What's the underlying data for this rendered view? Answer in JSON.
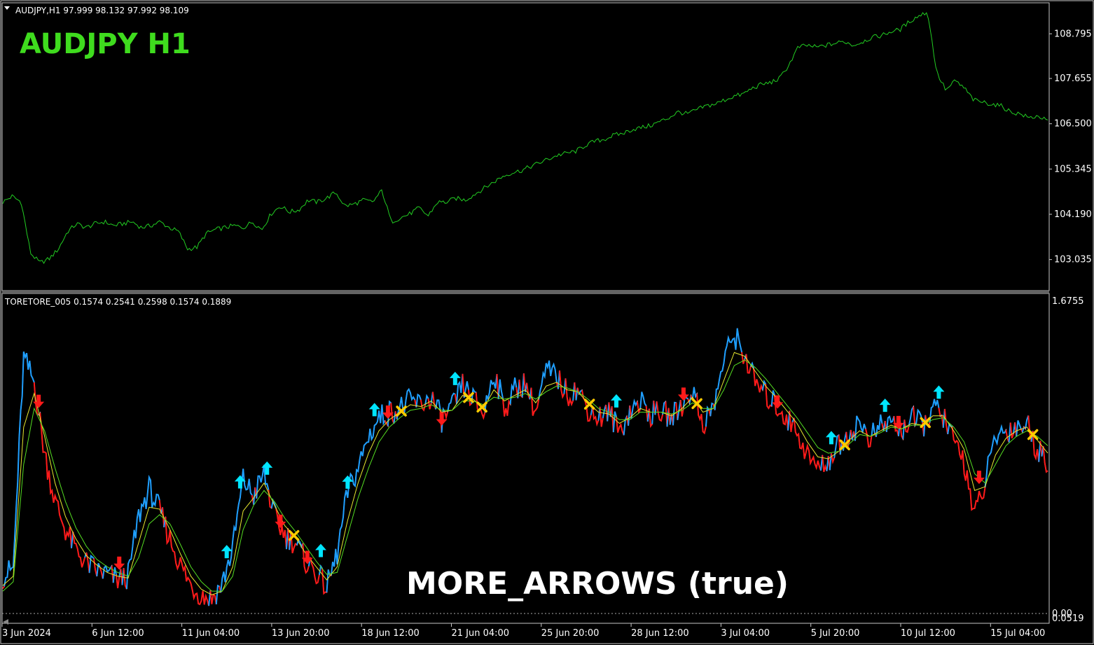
{
  "main_panel": {
    "header": "AUDJPY,H1  97.999 98.132 97.992 98.109",
    "symbol_label": "AUDJPY  H1",
    "symbol_color": "#3fdc1e"
  },
  "indicator_panel": {
    "header": "TORETORE_005 0.1574 0.2541 0.2598 0.1574 0.1889",
    "overlay_label": "MORE_ARROWS (true)"
  },
  "colors": {
    "price_line": "#22cc22",
    "bull_line": "#1e9fff",
    "bear_line": "#ff1a1a",
    "pink_line": "#ffb6c1",
    "green_signal": "#55dd22",
    "yellow_signal": "#e8e830",
    "up_arrow": "#00e5ff",
    "down_arrow": "#ff1a1a",
    "exit_cross": "#ffcc00",
    "axis_text": "#ffffff",
    "frame": "#c8c8c8"
  },
  "chart_data": [
    {
      "type": "line",
      "title": "AUDJPY  H1",
      "xlabel": "",
      "ylabel": "",
      "x_tick_labels": [
        "3 Jun 2024",
        "6 Jun 12:00",
        "11 Jun 04:00",
        "13 Jun 20:00",
        "18 Jun 12:00",
        "21 Jun 04:00",
        "25 Jun 20:00",
        "28 Jun 12:00",
        "3 Jul 04:00",
        "5 Jul 20:00",
        "10 Jul 12:00",
        "15 Jul 04:00"
      ],
      "y_tick_labels": [
        "108.795",
        "107.655",
        "106.500",
        "105.345",
        "104.190",
        "103.035"
      ],
      "ylim": [
        102.26,
        109.55
      ],
      "series": [
        {
          "values": [
            104.5,
            104.65,
            104.5,
            103.2,
            102.95,
            103.05,
            103.3,
            103.75,
            103.95,
            103.85,
            103.95,
            104.0,
            103.9,
            103.95,
            104.0,
            103.85,
            103.9,
            104.0,
            103.85,
            103.75,
            103.3,
            103.35,
            103.7,
            103.8,
            103.85,
            103.9,
            103.85,
            104.0,
            103.8,
            104.2,
            104.4,
            104.25,
            104.3,
            104.55,
            104.5,
            104.6,
            104.75,
            104.4,
            104.45,
            104.55,
            104.5,
            104.8,
            104.0,
            104.1,
            104.2,
            104.35,
            104.15,
            104.5,
            104.5,
            104.6,
            104.55,
            104.7,
            104.85,
            105.0,
            105.15,
            105.25,
            105.3,
            105.4,
            105.5,
            105.6,
            105.7,
            105.75,
            105.8,
            105.95,
            106.05,
            106.1,
            106.2,
            106.25,
            106.35,
            106.4,
            106.45,
            106.55,
            106.65,
            106.8,
            106.75,
            106.85,
            106.95,
            107.0,
            107.1,
            107.2,
            107.25,
            107.4,
            107.5,
            107.55,
            107.65,
            108.0,
            108.45,
            108.5,
            108.45,
            108.5,
            108.55,
            108.6,
            108.5,
            108.6,
            108.7,
            108.75,
            108.85,
            108.9,
            109.1,
            109.25,
            109.35,
            107.8,
            107.35,
            107.6,
            107.4,
            107.1,
            107.05,
            107.0,
            106.95,
            106.8,
            106.75,
            106.65,
            106.7,
            106.55
          ]
        }
      ]
    },
    {
      "type": "line",
      "title": "TORETORE_005",
      "xlabel": "",
      "ylabel": "",
      "y_tick_labels": [
        "1.6755",
        "0.00",
        "0.0519"
      ],
      "ylim": [
        0.0,
        1.6755
      ],
      "series": [
        {
          "values": [
            0.2,
            0.24,
            1.37,
            1.24,
            0.86,
            0.6,
            0.45,
            0.34,
            0.27,
            0.23,
            0.21,
            0.18,
            0.2,
            0.52,
            0.67,
            0.55,
            0.4,
            0.26,
            0.15,
            0.1,
            0.08,
            0.16,
            0.35,
            0.72,
            0.63,
            0.75,
            0.52,
            0.42,
            0.38,
            0.28,
            0.22,
            0.14,
            0.32,
            0.65,
            0.78,
            0.95,
            1.05,
            1.08,
            1.1,
            1.14,
            1.12,
            1.16,
            1.04,
            1.1,
            1.22,
            1.15,
            1.07,
            1.3,
            1.1,
            1.2,
            1.24,
            1.08,
            1.3,
            1.27,
            1.18,
            1.2,
            1.1,
            1.05,
            1.08,
            0.98,
            1.08,
            1.14,
            1.07,
            1.08,
            1.05,
            1.12,
            1.2,
            1.02,
            1.1,
            1.36,
            1.5,
            1.38,
            1.24,
            1.17,
            1.12,
            1.05,
            0.98,
            0.85,
            0.78,
            0.82,
            0.9,
            0.96,
            1.02,
            0.94,
            1.0,
            1.03,
            0.98,
            1.05,
            1.0,
            1.1,
            1.06,
            0.92,
            0.82,
            0.52,
            0.7,
            0.95,
            0.98,
            1.0,
            1.02,
            0.88,
            0.82
          ]
        },
        {
          "values": [
            0.15,
            0.2,
            1.0,
            1.18,
            0.95,
            0.7,
            0.52,
            0.4,
            0.31,
            0.26,
            0.22,
            0.2,
            0.19,
            0.38,
            0.57,
            0.56,
            0.45,
            0.32,
            0.2,
            0.13,
            0.1,
            0.12,
            0.25,
            0.55,
            0.62,
            0.7,
            0.58,
            0.47,
            0.41,
            0.32,
            0.25,
            0.18,
            0.25,
            0.5,
            0.7,
            0.86,
            0.98,
            1.04,
            1.08,
            1.12,
            1.11,
            1.14,
            1.08,
            1.09,
            1.17,
            1.15,
            1.1,
            1.2,
            1.14,
            1.17,
            1.2,
            1.13,
            1.22,
            1.24,
            1.2,
            1.19,
            1.13,
            1.08,
            1.07,
            1.02,
            1.05,
            1.1,
            1.08,
            1.08,
            1.06,
            1.1,
            1.16,
            1.08,
            1.1,
            1.25,
            1.4,
            1.38,
            1.3,
            1.22,
            1.16,
            1.09,
            1.02,
            0.92,
            0.84,
            0.83,
            0.87,
            0.93,
            0.98,
            0.95,
            0.98,
            1.01,
            0.99,
            1.02,
            1.01,
            1.06,
            1.06,
            0.98,
            0.88,
            0.66,
            0.68,
            0.85,
            0.94,
            0.98,
            1.0,
            0.93,
            0.86
          ]
        },
        {
          "values": [
            0.12,
            0.17,
            0.8,
            1.1,
            0.98,
            0.78,
            0.6,
            0.46,
            0.36,
            0.29,
            0.25,
            0.22,
            0.2,
            0.3,
            0.48,
            0.53,
            0.48,
            0.37,
            0.25,
            0.17,
            0.12,
            0.12,
            0.2,
            0.45,
            0.58,
            0.66,
            0.6,
            0.51,
            0.44,
            0.36,
            0.28,
            0.21,
            0.22,
            0.42,
            0.62,
            0.78,
            0.92,
            1.0,
            1.05,
            1.09,
            1.1,
            1.12,
            1.09,
            1.09,
            1.14,
            1.14,
            1.12,
            1.16,
            1.15,
            1.16,
            1.18,
            1.15,
            1.19,
            1.22,
            1.21,
            1.19,
            1.15,
            1.1,
            1.08,
            1.04,
            1.04,
            1.08,
            1.08,
            1.08,
            1.07,
            1.09,
            1.13,
            1.1,
            1.1,
            1.2,
            1.33,
            1.36,
            1.32,
            1.26,
            1.19,
            1.12,
            1.05,
            0.97,
            0.89,
            0.86,
            0.87,
            0.91,
            0.96,
            0.95,
            0.97,
            1.0,
            0.99,
            1.01,
            1.01,
            1.04,
            1.05,
            1.0,
            0.92,
            0.75,
            0.7,
            0.8,
            0.9,
            0.95,
            0.98,
            0.95,
            0.9
          ]
        }
      ]
    }
  ]
}
